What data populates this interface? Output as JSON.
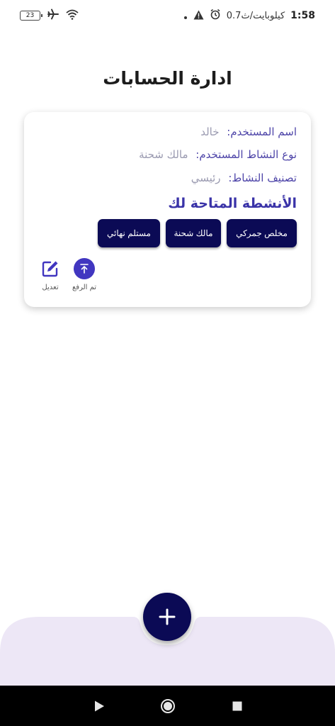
{
  "status_bar": {
    "time": "1:58",
    "speed": "0.7كيلوبايت/ث",
    "battery": "23",
    "icons": [
      "alarm-icon",
      "warning-icon",
      "dot-icon",
      "wifi-icon",
      "airplane-icon",
      "battery-icon"
    ]
  },
  "page": {
    "title": "ادارة الحسابات"
  },
  "account_card": {
    "name_label": "اسم المستخدم:",
    "name_value": "خالد",
    "activity_type_label": "نوع النشاط المستخدم:",
    "activity_type_value": "مالك شحنة",
    "classification_label": "تصنيف النشاط:",
    "classification_value": "رئيسي",
    "activities_title": "الأنشطة المتاحة لك",
    "activities": [
      "مخلص جمركي",
      "مالك شحنة",
      "مستلم نهائي"
    ],
    "uploaded_label": "تم الرفع",
    "edit_label": "تعديل"
  },
  "colors": {
    "primary": "#0b0a55",
    "accent": "#4136c0",
    "label": "#4d44a8",
    "bottom_bar": "#ede7f6"
  },
  "fab": {
    "icon": "plus-icon"
  },
  "nav_bar": {
    "icons": [
      "back-triangle-icon",
      "home-circle-icon",
      "recents-square-icon"
    ]
  }
}
